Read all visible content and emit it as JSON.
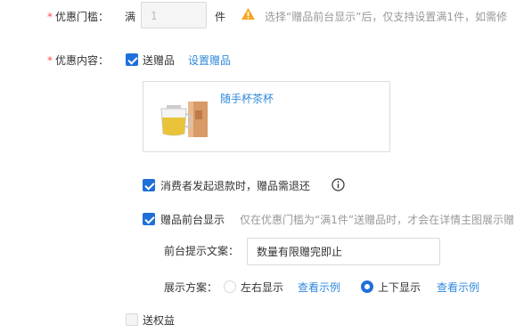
{
  "threshold": {
    "required_mark": "*",
    "label": "优惠门槛：",
    "prefix": "满",
    "value": "1",
    "unit": "件",
    "notice": "选择“赠品前台显示”后，仅支持设置满1件，如需修",
    "warning_color": "#f5a623"
  },
  "content": {
    "required_mark": "*",
    "label": "优惠内容：",
    "gift_option": {
      "checked": true,
      "label": "送赠品"
    },
    "set_gift_link": "设置赠品",
    "gift": {
      "name": "随手杯茶杯",
      "icon": "glass-teacup-image"
    },
    "refund_option": {
      "checked": true,
      "label": "消费者发起退款时，赠品需退还",
      "info_icon": "info-circle-icon"
    },
    "display_option": {
      "checked": true,
      "label": "赠品前台显示",
      "hint": "仅在优惠门槛为“满1件”送赠品时，才会在详情主图展示赠"
    },
    "prompt": {
      "label": "前台提示文案：",
      "value": "数量有限赠完即止"
    },
    "layout": {
      "label": "展示方案：",
      "options": [
        {
          "label": "左右显示",
          "selected": false,
          "example": "查看示例"
        },
        {
          "label": "上下显示",
          "selected": true,
          "example": "查看示例"
        }
      ]
    },
    "rights_option": {
      "checked": false,
      "label": "送权益"
    }
  },
  "colors": {
    "accent": "#1f6fd8",
    "link": "#3089dc",
    "required": "#ff4d4f"
  }
}
